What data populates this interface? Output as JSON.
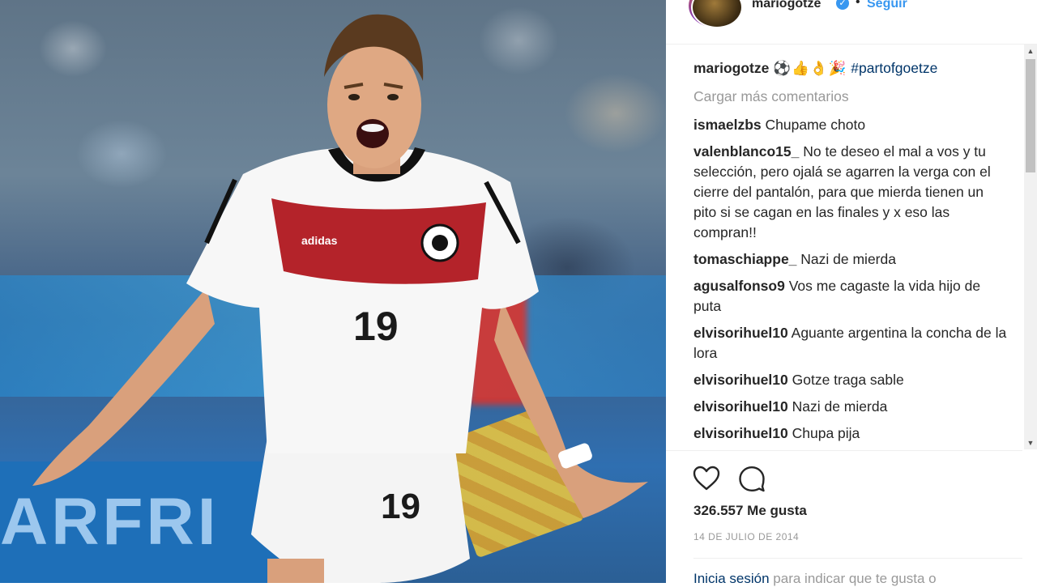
{
  "header": {
    "username": "mariogotze",
    "dot": "•",
    "follow_label": "Seguir"
  },
  "caption": {
    "username": "mariogotze",
    "emojis": "⚽👍👌🎉",
    "hashtag": "#partofgoetze"
  },
  "load_more_label": "Cargar más comentarios",
  "comments": [
    {
      "username": "ismaelzbs",
      "text": "Chupame choto"
    },
    {
      "username": "valenblanco15_",
      "text": "No te deseo el mal a vos y tu selección, pero ojalá se agarren la verga con el cierre del pantalón, para que mierda tienen un pito si se cagan en las finales y x eso las compran!!"
    },
    {
      "username": "tomaschiappe_",
      "text": "Nazi de mierda"
    },
    {
      "username": "agusalfonso9",
      "text": "Vos me cagaste la vida hijo de puta"
    },
    {
      "username": "elvisorihuel10",
      "text": "Aguante argentina la concha de la lora"
    },
    {
      "username": "elvisorihuel10",
      "text": "Gotze traga sable"
    },
    {
      "username": "elvisorihuel10",
      "text": "Nazi de mierda"
    },
    {
      "username": "elvisorihuel10",
      "text": "Chupa pija"
    }
  ],
  "likes_label": "326.557 Me gusta",
  "date_label": "14 DE JULIO DE 2014",
  "login": {
    "link": "Inicia sesión",
    "text": "para indicar que te gusta o"
  },
  "photo": {
    "jersey_number": "19",
    "ad_text": "ARFRI",
    "brand_text": "adidas"
  },
  "icons": {
    "like": "heart-icon",
    "comment": "comment-icon",
    "verified": "verified-badge-icon"
  },
  "colors": {
    "link_blue": "#3897f0",
    "hashtag_blue": "#003569",
    "muted_gray": "#999999",
    "text_dark": "#262626"
  }
}
